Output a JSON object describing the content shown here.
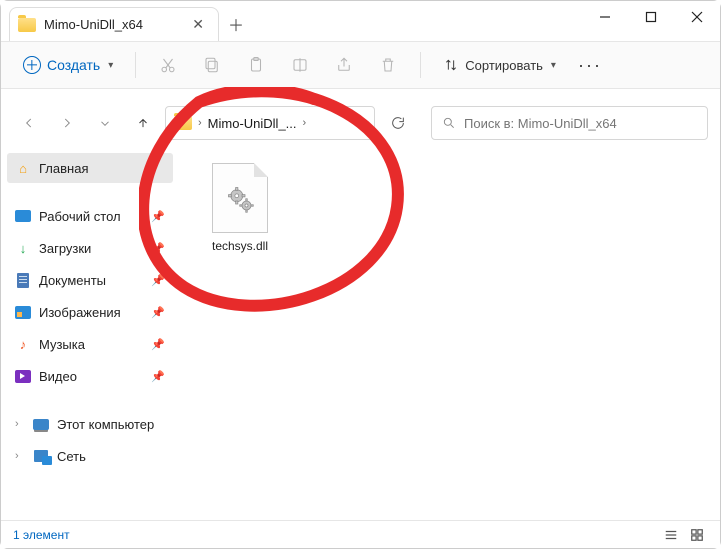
{
  "tab": {
    "title": "Mimo-UniDll_x64"
  },
  "toolbar": {
    "create_label": "Создать",
    "sort_label": "Сортировать"
  },
  "breadcrumb": {
    "folder": "Mimo-UniDll_..."
  },
  "search": {
    "placeholder": "Поиск в: Mimo-UniDll_x64"
  },
  "sidebar": {
    "home": "Главная",
    "desktop": "Рабочий стол",
    "downloads": "Загрузки",
    "documents": "Документы",
    "pictures": "Изображения",
    "music": "Музыка",
    "video": "Видео",
    "thispc": "Этот компьютер",
    "network": "Сеть"
  },
  "files": [
    {
      "name": "techsys.dll"
    }
  ],
  "status": {
    "count_text": "1 элемент"
  }
}
